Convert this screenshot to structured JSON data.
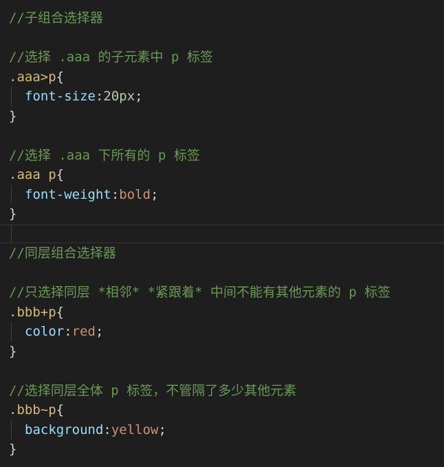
{
  "editor": {
    "colors": {
      "background": "#1e1e1e",
      "comment": "#6a9955",
      "selector": "#d7ba7d",
      "property": "#9cdcfe",
      "number": "#b5cea8",
      "value": "#ce9178",
      "punctuation": "#d4d4d4"
    },
    "lines": {
      "l1": {
        "comment": "//子组合选择器"
      },
      "l3": {
        "comment": "//选择 .aaa 的子元素中 p 标签"
      },
      "l4": {
        "selector": ".aaa>p",
        "brace": "{"
      },
      "l5": {
        "property": "font-size",
        "colon": ":",
        "value": "20px",
        "semi": ";"
      },
      "l6": {
        "brace": "}"
      },
      "l8": {
        "comment": "//选择 .aaa 下所有的 p 标签"
      },
      "l9": {
        "selector": ".aaa p",
        "brace": "{"
      },
      "l10": {
        "property": "font-weight",
        "colon": ":",
        "value": "bold",
        "semi": ";"
      },
      "l11": {
        "brace": "}"
      },
      "l13": {
        "comment": "//同层组合选择器"
      },
      "l15": {
        "comment": "//只选择同层 *相邻* *紧跟着* 中间不能有其他元素的 p 标签"
      },
      "l16": {
        "selector": ".bbb+p",
        "brace": "{"
      },
      "l17": {
        "property": "color",
        "colon": ":",
        "value": "red",
        "semi": ";"
      },
      "l18": {
        "brace": "}"
      },
      "l20": {
        "comment": "//选择同层全体 p 标签，不管隔了多少其他元素"
      },
      "l21": {
        "selector": ".bbb~p",
        "brace": "{"
      },
      "l22": {
        "property": "background",
        "colon": ":",
        "value": "yellow",
        "semi": ";"
      },
      "l23": {
        "brace": "}"
      }
    }
  }
}
